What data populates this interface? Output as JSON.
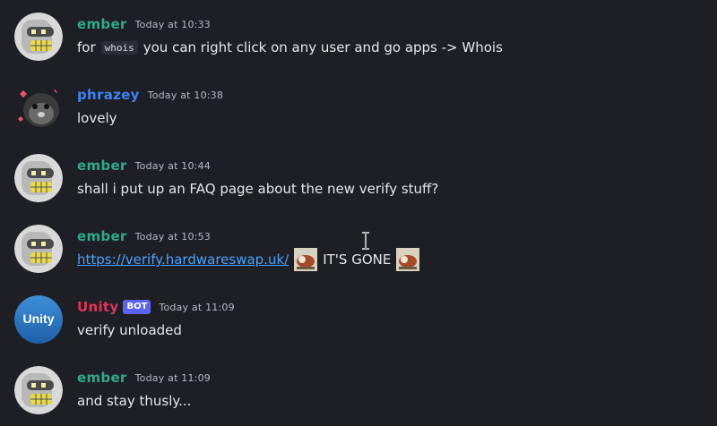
{
  "colors": {
    "background": "#1e1f24",
    "ember_name": "#2fa98b",
    "phrazey_name": "#3b82f6",
    "unity_name": "#e0345d",
    "link": "#4aa3ff",
    "bot_badge": "#5865f2"
  },
  "messages": [
    {
      "author": "ember",
      "timestamp": "Today at 10:33",
      "text_before": "for",
      "code": "whois",
      "text_after": "you can right click on any user and go apps -> Whois",
      "avatar_icon": "robot-avatar-icon"
    },
    {
      "author": "phrazey",
      "timestamp": "Today at 10:38",
      "text": "lovely",
      "avatar_icon": "fluffy-cat-avatar-icon"
    },
    {
      "author": "ember",
      "timestamp": "Today at 10:44",
      "text": "shall i put up an FAQ page about the new verify stuff?",
      "avatar_icon": "robot-avatar-icon"
    },
    {
      "author": "ember",
      "timestamp": "Today at 10:53",
      "link": "https://verify.hardwareswap.uk/",
      "text": "IT'S GONE",
      "emoji_icon": "cat-reaction-emoji-icon",
      "avatar_icon": "robot-avatar-icon"
    },
    {
      "author": "Unity",
      "badge": "BOT",
      "timestamp": "Today at 11:09",
      "text": "verify unloaded",
      "avatar_label": "Unity",
      "avatar_icon": "unity-logo-avatar-icon"
    },
    {
      "author": "ember",
      "timestamp": "Today at 11:09",
      "text": "and stay thusly...",
      "avatar_icon": "robot-avatar-icon"
    }
  ]
}
